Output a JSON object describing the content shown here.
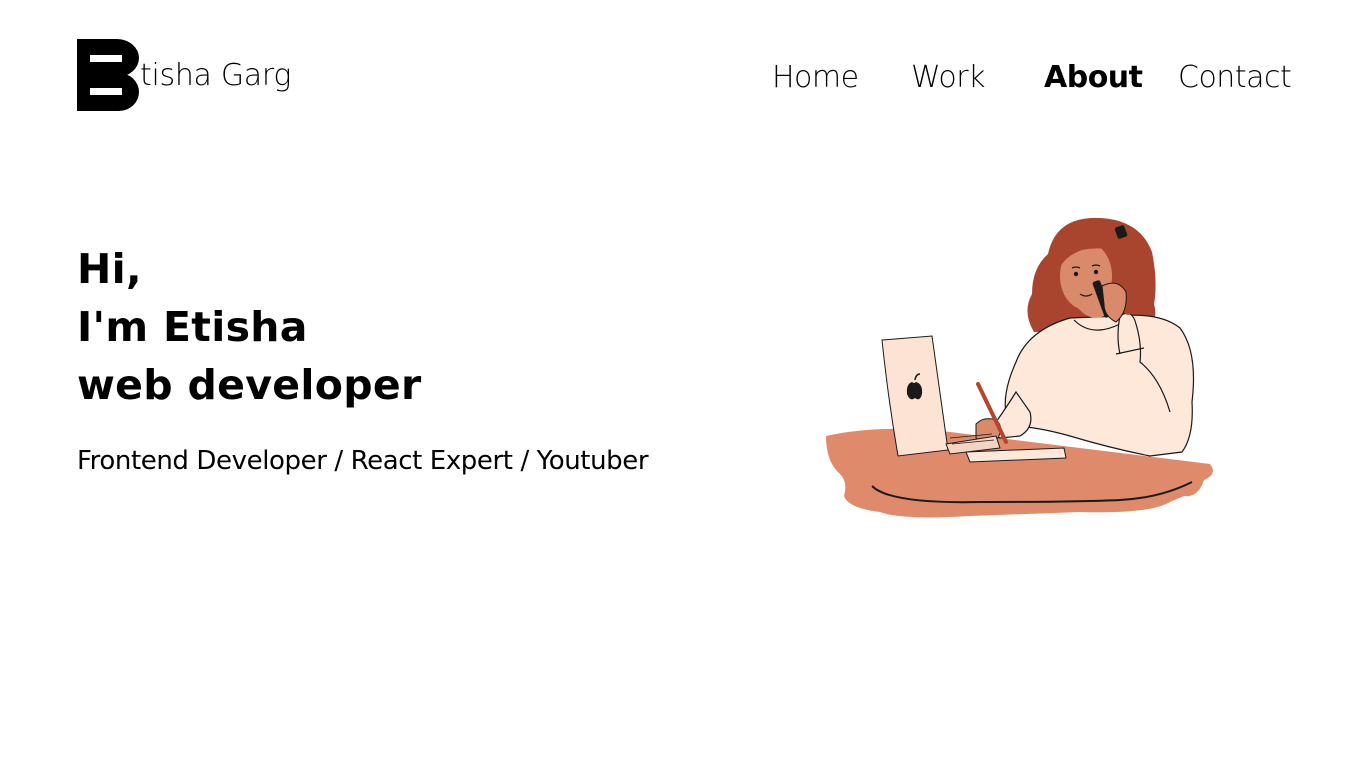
{
  "header": {
    "logo_text": "tisha Garg",
    "nav": [
      {
        "label": "Home",
        "active": false
      },
      {
        "label": "Work",
        "active": false
      },
      {
        "label": "About",
        "active": true
      },
      {
        "label": "Contact",
        "active": false
      }
    ]
  },
  "hero": {
    "lines": [
      "Hi,",
      "I'm Etisha",
      "web developer"
    ],
    "subtitle": "Frontend Developer / React Expert / Youtuber",
    "illustration": "woman-at-laptop-on-phone-illustration"
  },
  "colors": {
    "text": "#000000",
    "background": "#ffffff",
    "desk": "#e08a6c",
    "hair": "#a9452f",
    "skin": "#d98a6a",
    "sweater": "#fde8da",
    "laptop": "#fde3d3"
  }
}
